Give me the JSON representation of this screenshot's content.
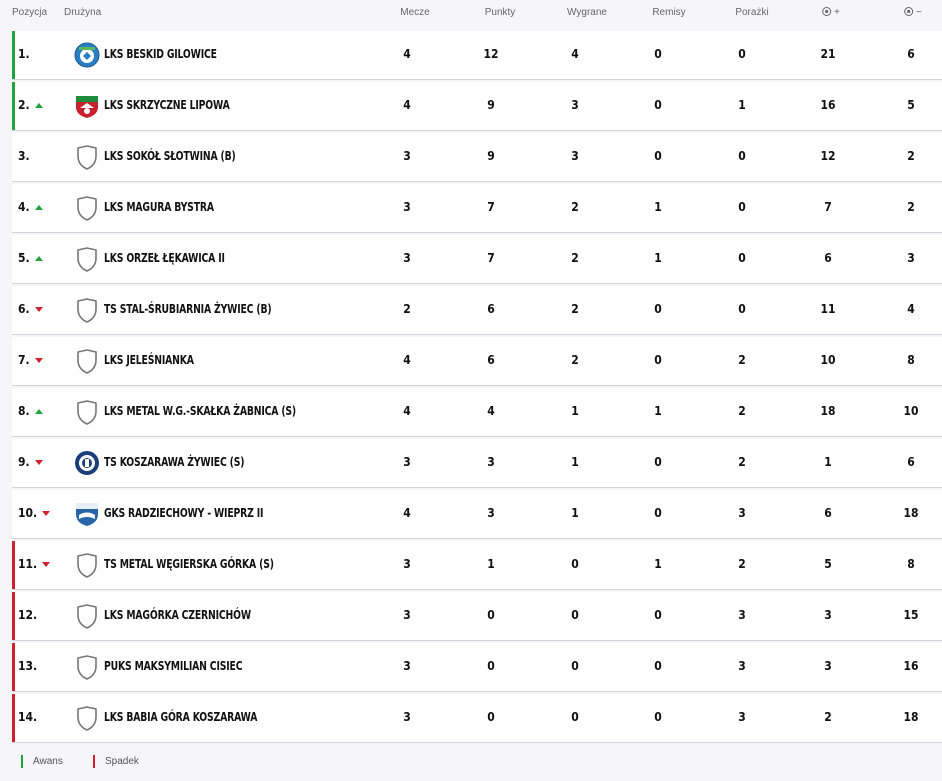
{
  "columns": {
    "position": "Pozycja",
    "team": "Drużyna",
    "played": "Mecze",
    "points": "Punkty",
    "wins": "Wygrane",
    "draws": "Remisy",
    "losses": "Porażki",
    "goals_for_sign": "+",
    "goals_against_sign": "−",
    "goals_for_icon": "football-icon",
    "goals_against_icon": "football-icon"
  },
  "colors": {
    "promotion": "#1fa33a",
    "relegation": "#d3202f",
    "trend_up": "#1fa33a",
    "trend_down": "#d3202f"
  },
  "rows": [
    {
      "pos": "1.",
      "trend": "none",
      "zone": "promotion",
      "crest": "beskid-crest",
      "team": "LKS Beskid Gilowice",
      "played": "4",
      "points": "12",
      "wins": "4",
      "draws": "0",
      "losses": "0",
      "gf": "21",
      "ga": "6"
    },
    {
      "pos": "2.",
      "trend": "up",
      "zone": "promotion",
      "crest": "lipowa-crest",
      "team": "LKS Skrzyczne Lipowa",
      "played": "4",
      "points": "9",
      "wins": "3",
      "draws": "0",
      "losses": "1",
      "gf": "16",
      "ga": "5"
    },
    {
      "pos": "3.",
      "trend": "none",
      "zone": "none",
      "crest": "shield-placeholder",
      "team": "LKS Sokół Słotwina (B)",
      "played": "3",
      "points": "9",
      "wins": "3",
      "draws": "0",
      "losses": "0",
      "gf": "12",
      "ga": "2"
    },
    {
      "pos": "4.",
      "trend": "up",
      "zone": "none",
      "crest": "shield-placeholder",
      "team": "LKS Magura Bystra",
      "played": "3",
      "points": "7",
      "wins": "2",
      "draws": "1",
      "losses": "0",
      "gf": "7",
      "ga": "2"
    },
    {
      "pos": "5.",
      "trend": "up",
      "zone": "none",
      "crest": "shield-placeholder",
      "team": "LKS Orzeł Łękawica II",
      "played": "3",
      "points": "7",
      "wins": "2",
      "draws": "1",
      "losses": "0",
      "gf": "6",
      "ga": "3"
    },
    {
      "pos": "6.",
      "trend": "down",
      "zone": "none",
      "crest": "shield-placeholder",
      "team": "TS Stal-Śrubiarnia Żywiec (B)",
      "played": "2",
      "points": "6",
      "wins": "2",
      "draws": "0",
      "losses": "0",
      "gf": "11",
      "ga": "4"
    },
    {
      "pos": "7.",
      "trend": "down",
      "zone": "none",
      "crest": "shield-placeholder",
      "team": "LKS Jeleśnianka",
      "played": "4",
      "points": "6",
      "wins": "2",
      "draws": "0",
      "losses": "2",
      "gf": "10",
      "ga": "8"
    },
    {
      "pos": "8.",
      "trend": "up",
      "zone": "none",
      "crest": "shield-placeholder",
      "team": "LKS Metal W.G.-Skałka Żabnica (S)",
      "played": "4",
      "points": "4",
      "wins": "1",
      "draws": "1",
      "losses": "2",
      "gf": "18",
      "ga": "10"
    },
    {
      "pos": "9.",
      "trend": "down",
      "zone": "none",
      "crest": "koszarawa-crest",
      "team": "TS Koszarawa Żywiec (S)",
      "played": "3",
      "points": "3",
      "wins": "1",
      "draws": "0",
      "losses": "2",
      "gf": "1",
      "ga": "6"
    },
    {
      "pos": "10.",
      "trend": "down",
      "zone": "none",
      "crest": "radziechowy-crest",
      "team": "GKS Radziechowy - Wieprz II",
      "played": "4",
      "points": "3",
      "wins": "1",
      "draws": "0",
      "losses": "3",
      "gf": "6",
      "ga": "18"
    },
    {
      "pos": "11.",
      "trend": "down",
      "zone": "relegation",
      "crest": "shield-placeholder",
      "team": "TS Metal Węgierska Górka (S)",
      "played": "3",
      "points": "1",
      "wins": "0",
      "draws": "1",
      "losses": "2",
      "gf": "5",
      "ga": "8"
    },
    {
      "pos": "12.",
      "trend": "none",
      "zone": "relegation",
      "crest": "shield-placeholder",
      "team": "LKS Magórka Czernichów",
      "played": "3",
      "points": "0",
      "wins": "0",
      "draws": "0",
      "losses": "3",
      "gf": "3",
      "ga": "15"
    },
    {
      "pos": "13.",
      "trend": "none",
      "zone": "relegation",
      "crest": "shield-placeholder",
      "team": "PUKS Maksymilian Cisiec",
      "played": "3",
      "points": "0",
      "wins": "0",
      "draws": "0",
      "losses": "3",
      "gf": "3",
      "ga": "16"
    },
    {
      "pos": "14.",
      "trend": "none",
      "zone": "relegation",
      "crest": "shield-placeholder",
      "team": "LKS Babia Góra Koszarawa",
      "played": "3",
      "points": "0",
      "wins": "0",
      "draws": "0",
      "losses": "3",
      "gf": "2",
      "ga": "18"
    }
  ],
  "legend": {
    "promotion_label": "Awans",
    "relegation_label": "Spadek"
  }
}
